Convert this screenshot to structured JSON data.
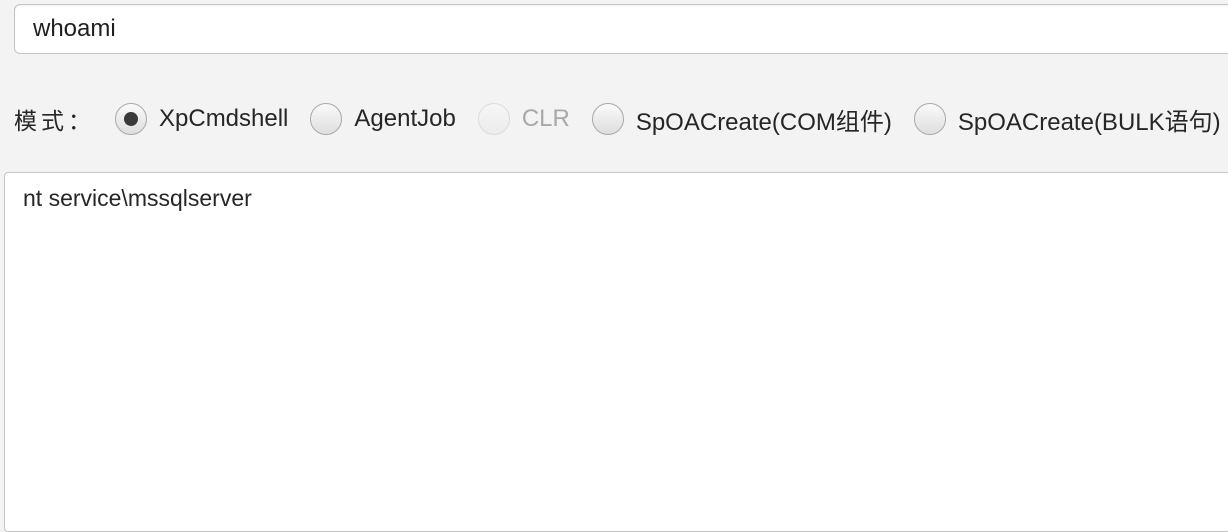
{
  "command_input": {
    "value": "whoami"
  },
  "mode": {
    "label": "模式：",
    "options": [
      {
        "label": "XpCmdshell",
        "selected": true,
        "enabled": true
      },
      {
        "label": "AgentJob",
        "selected": false,
        "enabled": true
      },
      {
        "label": "CLR",
        "selected": false,
        "enabled": false
      },
      {
        "label": "SpOACreate(COM组件)",
        "selected": false,
        "enabled": true
      },
      {
        "label": "SpOACreate(BULK语句)",
        "selected": false,
        "enabled": true
      }
    ]
  },
  "output": {
    "text": "nt service\\mssqlserver"
  }
}
